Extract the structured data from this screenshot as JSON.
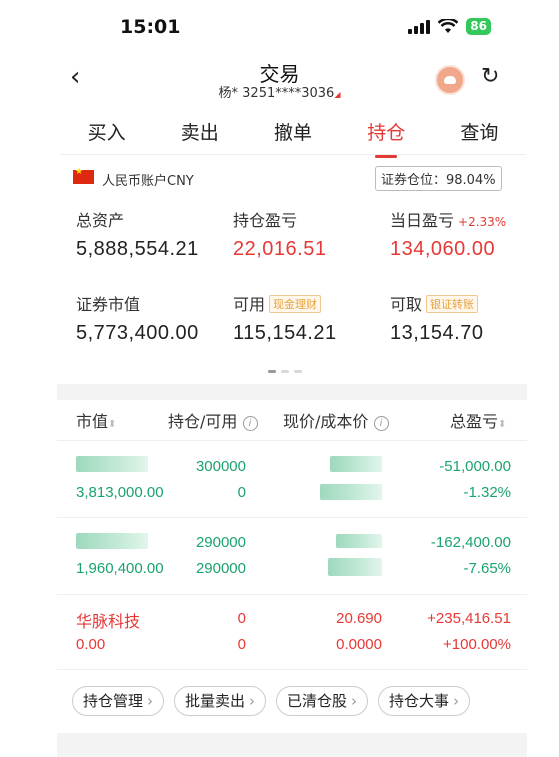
{
  "status_bar": {
    "time": "15:01",
    "battery": "86"
  },
  "header": {
    "title": "交易",
    "account": "杨* 3251****3036"
  },
  "tabs": [
    "买入",
    "卖出",
    "撤单",
    "持仓",
    "查询"
  ],
  "active_tab": "持仓",
  "account_card": {
    "currency": "人民币账户CNY",
    "position_ratio": "证券仓位：98.04%",
    "total_assets_label": "总资产",
    "total_assets": "5,888,554.21",
    "holding_pnl_label": "持仓盈亏",
    "holding_pnl": "22,016.51",
    "daily_pnl_label": "当日盈亏",
    "daily_pnl_pct": "+2.33%",
    "daily_pnl": "134,060.00",
    "market_value_label": "证券市值",
    "market_value": "5,773,400.00",
    "available_label": "可用",
    "available_tag": "现金理财",
    "available": "115,154.21",
    "withdrawable_label": "可取",
    "withdrawable_tag": "银证转账",
    "withdrawable": "13,154.70"
  },
  "holdings": {
    "headers": {
      "market_value": "市值",
      "position": "持仓/可用",
      "price": "现价/成本价",
      "pnl": "总盈亏"
    },
    "rows": [
      {
        "name": "",
        "market_value": "3,813,000.00",
        "position": "300000",
        "available": "0",
        "price": "",
        "cost": "",
        "pnl": "-51,000.00",
        "pnl_pct": "-1.32%",
        "color": "#1aa36c"
      },
      {
        "name": "",
        "market_value": "1,960,400.00",
        "position": "290000",
        "available": "290000",
        "price": "",
        "cost": "",
        "pnl": "-162,400.00",
        "pnl_pct": "-7.65%",
        "color": "#1aa36c"
      },
      {
        "name": "华脉科技",
        "market_value": "0.00",
        "position": "0",
        "available": "0",
        "price": "20.690",
        "cost": "0.0000",
        "pnl": "+235,416.51",
        "pnl_pct": "+100.00%",
        "color": "#e53935"
      }
    ]
  },
  "actions": [
    "持仓管理",
    "批量卖出",
    "已清仓股",
    "持仓大事"
  ],
  "colors": {
    "accent": "#e53935",
    "loss": "#1aa36c",
    "gain": "#e53935"
  }
}
